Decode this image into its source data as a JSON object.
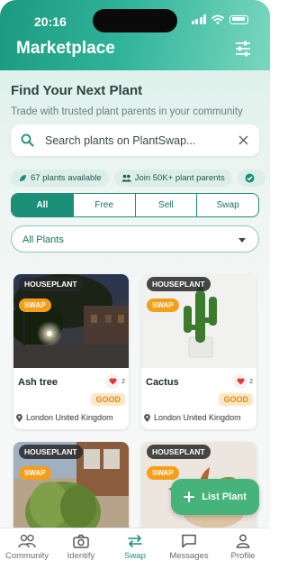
{
  "status": {
    "time": "20:16"
  },
  "header": {
    "title": "Marketplace",
    "filter_icon": "sliders-icon"
  },
  "main": {
    "heading": "Find Your Next Plant",
    "subheading": "Trade with trusted plant parents in your community",
    "search": {
      "placeholder": "Search plants on PlantSwap..."
    },
    "chips": [
      {
        "label": "67 plants available",
        "icon": "leaf-icon"
      },
      {
        "label": "Join 50K+ plant parents",
        "icon": "people-icon"
      },
      {
        "label": "",
        "icon": "verified-icon"
      }
    ],
    "segments": [
      {
        "label": "All",
        "active": true
      },
      {
        "label": "Free",
        "active": false
      },
      {
        "label": "Sell",
        "active": false
      },
      {
        "label": "Swap",
        "active": false
      }
    ],
    "category_select": {
      "value": "All Plants"
    },
    "listings": [
      {
        "type": "HOUSEPLANT",
        "mode": "SWAP",
        "name": "Ash tree",
        "likes": "2",
        "condition": "GOOD",
        "location": "London United Kingdom"
      },
      {
        "type": "HOUSEPLANT",
        "mode": "SWAP",
        "name": "Cactus",
        "likes": "2",
        "condition": "GOOD",
        "location": "London United Kingdom"
      },
      {
        "type": "HOUSEPLANT",
        "mode": "SWAP"
      },
      {
        "type": "HOUSEPLANT",
        "mode": "SWAP"
      }
    ],
    "fab": {
      "label": "List Plant"
    }
  },
  "tabbar": [
    {
      "label": "Community",
      "icon": "people-icon",
      "active": false
    },
    {
      "label": "Identify",
      "icon": "camera-icon",
      "active": false
    },
    {
      "label": "Swap",
      "icon": "swap-arrows-icon",
      "active": true
    },
    {
      "label": "Messages",
      "icon": "chat-icon",
      "active": false
    },
    {
      "label": "Profile",
      "icon": "person-icon",
      "active": false
    }
  ],
  "colors": {
    "primary": "#1b8f78",
    "accent_orange": "#f59e1a",
    "fab": "#46b37a"
  }
}
